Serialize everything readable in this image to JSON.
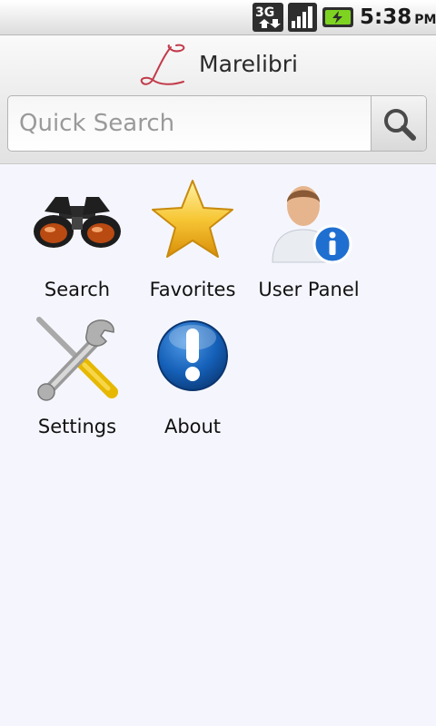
{
  "status_bar": {
    "network": "3G",
    "time": "5:38",
    "ampm": "PM",
    "icons": [
      "network-3g-icon",
      "signal-icon",
      "battery-charging-icon"
    ]
  },
  "header": {
    "title": "Marelibri",
    "logo_icon": "marelibri-logo"
  },
  "search": {
    "placeholder": "Quick Search",
    "button_icon": "magnifier-icon"
  },
  "menu": {
    "items": [
      {
        "label": "Search",
        "icon": "binoculars-icon"
      },
      {
        "label": "Favorites",
        "icon": "star-icon"
      },
      {
        "label": "User Panel",
        "icon": "user-info-icon"
      },
      {
        "label": "Settings",
        "icon": "wrench-screwdriver-icon"
      },
      {
        "label": "About",
        "icon": "exclamation-icon"
      }
    ]
  },
  "colors": {
    "background": "#f5f6fd",
    "logo_red": "#c23b4a",
    "star_gold": "#f3b51c",
    "about_blue": "#1560b8",
    "info_blue": "#1f6fd1"
  }
}
